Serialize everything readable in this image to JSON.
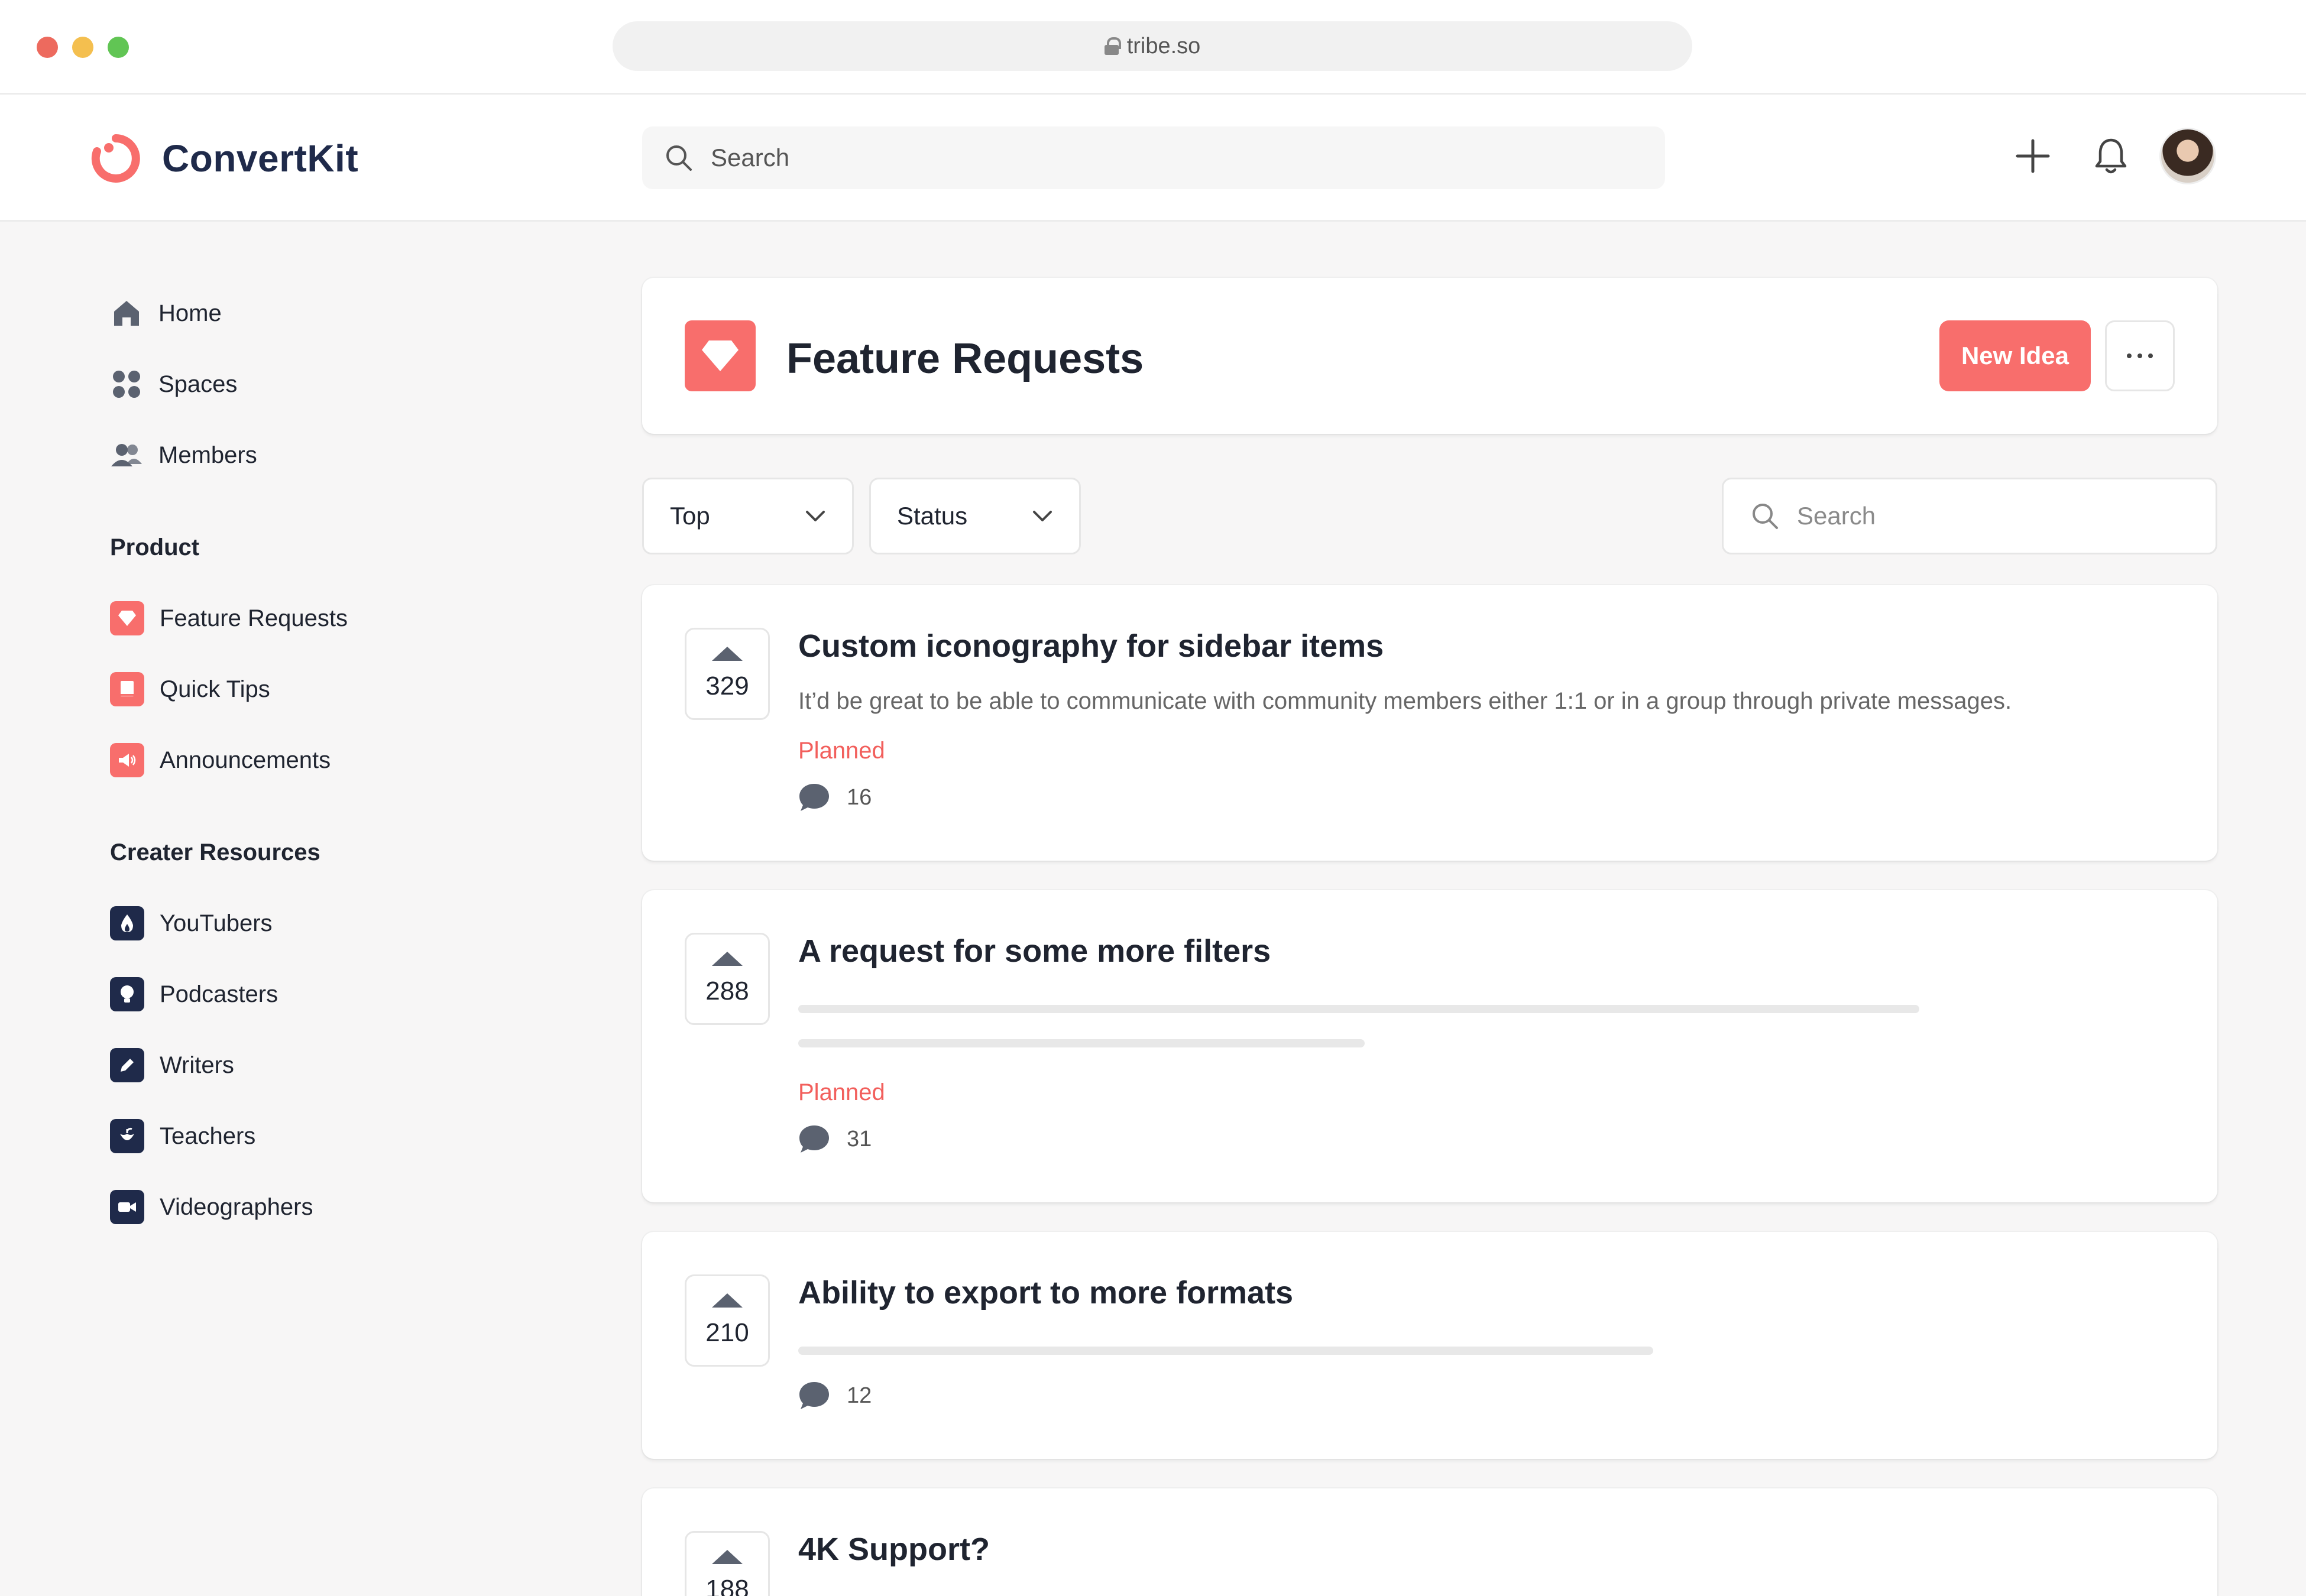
{
  "browser": {
    "url": "tribe.so"
  },
  "header": {
    "brand": "ConvertKit",
    "search_placeholder": "Search"
  },
  "sidebar": {
    "main_items": [
      {
        "label": "Home",
        "icon": "home-icon"
      },
      {
        "label": "Spaces",
        "icon": "grid-icon"
      },
      {
        "label": "Members",
        "icon": "members-icon"
      }
    ],
    "sections": [
      {
        "title": "Product",
        "items": [
          {
            "label": "Feature Requests",
            "icon": "diamond-icon",
            "color": "#f86e6c"
          },
          {
            "label": "Quick Tips",
            "icon": "book-icon",
            "color": "#f86e6c"
          },
          {
            "label": "Announcements",
            "icon": "megaphone-icon",
            "color": "#f86e6c"
          }
        ]
      },
      {
        "title": "Creater Resources",
        "items": [
          {
            "label": "YouTubers",
            "icon": "flame-icon",
            "color": "#1f2a4a"
          },
          {
            "label": "Podcasters",
            "icon": "bulb-icon",
            "color": "#1f2a4a"
          },
          {
            "label": "Writers",
            "icon": "pen-icon",
            "color": "#1f2a4a"
          },
          {
            "label": "Teachers",
            "icon": "apple-icon",
            "color": "#1f2a4a"
          },
          {
            "label": "Videographers",
            "icon": "video-icon",
            "color": "#1f2a4a"
          }
        ]
      }
    ]
  },
  "main": {
    "title": "Feature Requests",
    "new_idea_label": "New Idea",
    "filters": {
      "sort": "Top",
      "status": "Status",
      "search_placeholder": "Search"
    },
    "posts": [
      {
        "votes": "329",
        "title": "Custom iconography for sidebar items",
        "body": "It’d be great to be able to communicate with community members either 1:1 or in a group through private messages.",
        "status": "Planned",
        "comments": "16"
      },
      {
        "votes": "288",
        "title": "A request for some more filters",
        "status": "Planned",
        "comments": "31"
      },
      {
        "votes": "210",
        "title": "Ability to export to more formats",
        "comments": "12"
      },
      {
        "votes": "188",
        "title": "4K Support?"
      }
    ]
  },
  "colors": {
    "accent": "#f86e6c",
    "navy": "#1f2a4a",
    "status_planned": "#f25f5c"
  }
}
